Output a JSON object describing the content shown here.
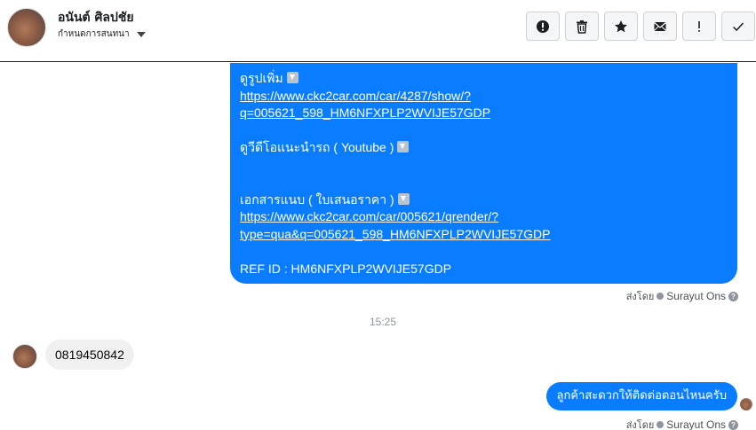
{
  "header": {
    "contact_name": "อนันต์ ศิลปชัย",
    "subtitle": "กำหนดการสนทนา",
    "toolbar": [
      {
        "name": "report-button",
        "icon": "alert-circle-icon"
      },
      {
        "name": "delete-button",
        "icon": "trash-icon"
      },
      {
        "name": "star-button",
        "icon": "star-icon"
      },
      {
        "name": "mark-unread-button",
        "icon": "envelope-icon"
      },
      {
        "name": "priority-button",
        "icon": "exclamation-icon"
      },
      {
        "name": "mark-done-button",
        "icon": "checkmark-icon"
      }
    ]
  },
  "messages": {
    "big_bubble": {
      "more_photos_label": "ดูรูปเพิ่ม",
      "link1_line1": "https://www.ckc2car.com/car/4287/show/?",
      "link1_line2": "q=005621_598_HM6NFXPLP2WVIJE57GDP",
      "video_label": "ดูวีดีโอแนะนำรถ ( Youtube )",
      "docs_label": "เอกสารแนบ ( ใบเสนอราคา )",
      "link2_line1": "https://www.ckc2car.com/car/005621/qrender/?",
      "link2_line2": "type=qua&q=005621_598_HM6NFXPLP2WVIJE57GDP",
      "ref_id": "REF ID : HM6NFXPLP2WVIJE57GDP"
    },
    "sent_by_prefix": "ส่งโดย",
    "sent_by_name": "Surayut Ons",
    "timestamp": "15:25",
    "incoming_text": "0819450842",
    "outgoing_text": "ลูกค้าสะดวกให้ติดต่อตอนไหนครับ"
  },
  "colors": {
    "accent": "#0a7cff",
    "incoming_bg": "#f1f0f0"
  }
}
